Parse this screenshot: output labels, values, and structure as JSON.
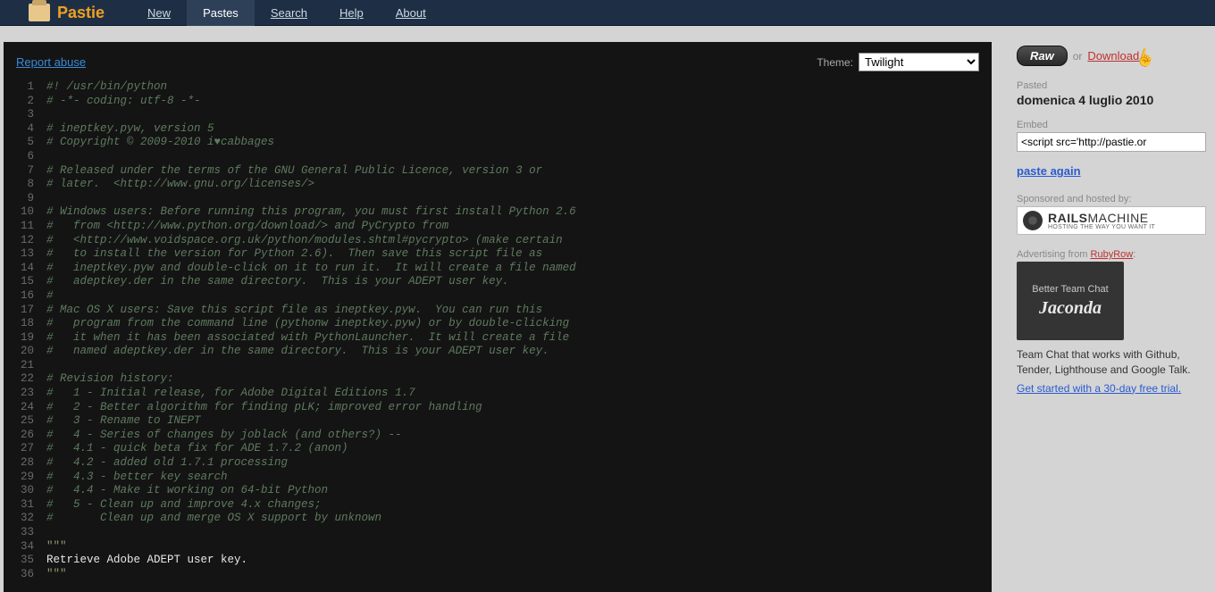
{
  "brand": "Pastie",
  "nav": {
    "new": "New",
    "pastes": "Pastes",
    "search": "Search",
    "help": "Help",
    "about": "About"
  },
  "report_abuse": "Report abuse",
  "theme_label": "Theme:",
  "theme_selected": "Twilight",
  "code": [
    {
      "n": 1,
      "t": "#! /usr/bin/python",
      "c": "comment"
    },
    {
      "n": 2,
      "t": "# -*- coding: utf-8 -*-",
      "c": "comment"
    },
    {
      "n": 3,
      "t": "",
      "c": "comment"
    },
    {
      "n": 4,
      "t": "# ineptkey.pyw, version 5",
      "c": "comment"
    },
    {
      "n": 5,
      "t": "# Copyright © 2009-2010 i♥cabbages",
      "c": "comment"
    },
    {
      "n": 6,
      "t": "",
      "c": "comment"
    },
    {
      "n": 7,
      "t": "# Released under the terms of the GNU General Public Licence, version 3 or",
      "c": "comment"
    },
    {
      "n": 8,
      "t": "# later.  <http://www.gnu.org/licenses/>",
      "c": "comment"
    },
    {
      "n": 9,
      "t": "",
      "c": "comment"
    },
    {
      "n": 10,
      "t": "# Windows users: Before running this program, you must first install Python 2.6",
      "c": "comment"
    },
    {
      "n": 11,
      "t": "#   from <http://www.python.org/download/> and PyCrypto from",
      "c": "comment"
    },
    {
      "n": 12,
      "t": "#   <http://www.voidspace.org.uk/python/modules.shtml#pycrypto> (make certain",
      "c": "comment"
    },
    {
      "n": 13,
      "t": "#   to install the version for Python 2.6).  Then save this script file as",
      "c": "comment"
    },
    {
      "n": 14,
      "t": "#   ineptkey.pyw and double-click on it to run it.  It will create a file named",
      "c": "comment"
    },
    {
      "n": 15,
      "t": "#   adeptkey.der in the same directory.  This is your ADEPT user key.",
      "c": "comment"
    },
    {
      "n": 16,
      "t": "#",
      "c": "comment"
    },
    {
      "n": 17,
      "t": "# Mac OS X users: Save this script file as ineptkey.pyw.  You can run this",
      "c": "comment"
    },
    {
      "n": 18,
      "t": "#   program from the command line (pythonw ineptkey.pyw) or by double-clicking",
      "c": "comment"
    },
    {
      "n": 19,
      "t": "#   it when it has been associated with PythonLauncher.  It will create a file",
      "c": "comment"
    },
    {
      "n": 20,
      "t": "#   named adeptkey.der in the same directory.  This is your ADEPT user key.",
      "c": "comment"
    },
    {
      "n": 21,
      "t": "",
      "c": "comment"
    },
    {
      "n": 22,
      "t": "# Revision history:",
      "c": "comment"
    },
    {
      "n": 23,
      "t": "#   1 - Initial release, for Adobe Digital Editions 1.7",
      "c": "comment"
    },
    {
      "n": 24,
      "t": "#   2 - Better algorithm for finding pLK; improved error handling",
      "c": "comment"
    },
    {
      "n": 25,
      "t": "#   3 - Rename to INEPT",
      "c": "comment"
    },
    {
      "n": 26,
      "t": "#   4 - Series of changes by joblack (and others?) --",
      "c": "comment"
    },
    {
      "n": 27,
      "t": "#   4.1 - quick beta fix for ADE 1.7.2 (anon)",
      "c": "comment"
    },
    {
      "n": 28,
      "t": "#   4.2 - added old 1.7.1 processing",
      "c": "comment"
    },
    {
      "n": 29,
      "t": "#   4.3 - better key search",
      "c": "comment"
    },
    {
      "n": 30,
      "t": "#   4.4 - Make it working on 64-bit Python",
      "c": "comment"
    },
    {
      "n": 31,
      "t": "#   5 - Clean up and improve 4.x changes;",
      "c": "comment"
    },
    {
      "n": 32,
      "t": "#       Clean up and merge OS X support by unknown",
      "c": "comment"
    },
    {
      "n": 33,
      "t": "",
      "c": "comment"
    },
    {
      "n": 34,
      "t": "\"\"\"",
      "c": "string"
    },
    {
      "n": 35,
      "t": "Retrieve Adobe ADEPT user key.",
      "c": "normal"
    },
    {
      "n": 36,
      "t": "\"\"\"",
      "c": "string"
    }
  ],
  "sidebar": {
    "raw": "Raw",
    "or": "or",
    "download": "Download",
    "pasted_label": "Pasted",
    "pasted_value": "domenica 4 luglio 2010",
    "embed_label": "Embed",
    "embed_value": "<script src='http://pastie.or",
    "paste_again": "paste again",
    "sponsor_label": "Sponsored and hosted by:",
    "sponsor_main": "RAILS",
    "sponsor_sub": "MACHINE",
    "sponsor_tag": "HOSTING THE WAY YOU WANT IT",
    "ad_label_pre": "Advertising from ",
    "ad_label_link": "RubyRow",
    "ad_t1": "Better Team Chat",
    "ad_t2": "Jaconda",
    "ad_desc": "Team Chat that works with Github, Tender, Lighthouse and Google Talk.",
    "ad_cta": "Get started with a 30-day free trial."
  }
}
